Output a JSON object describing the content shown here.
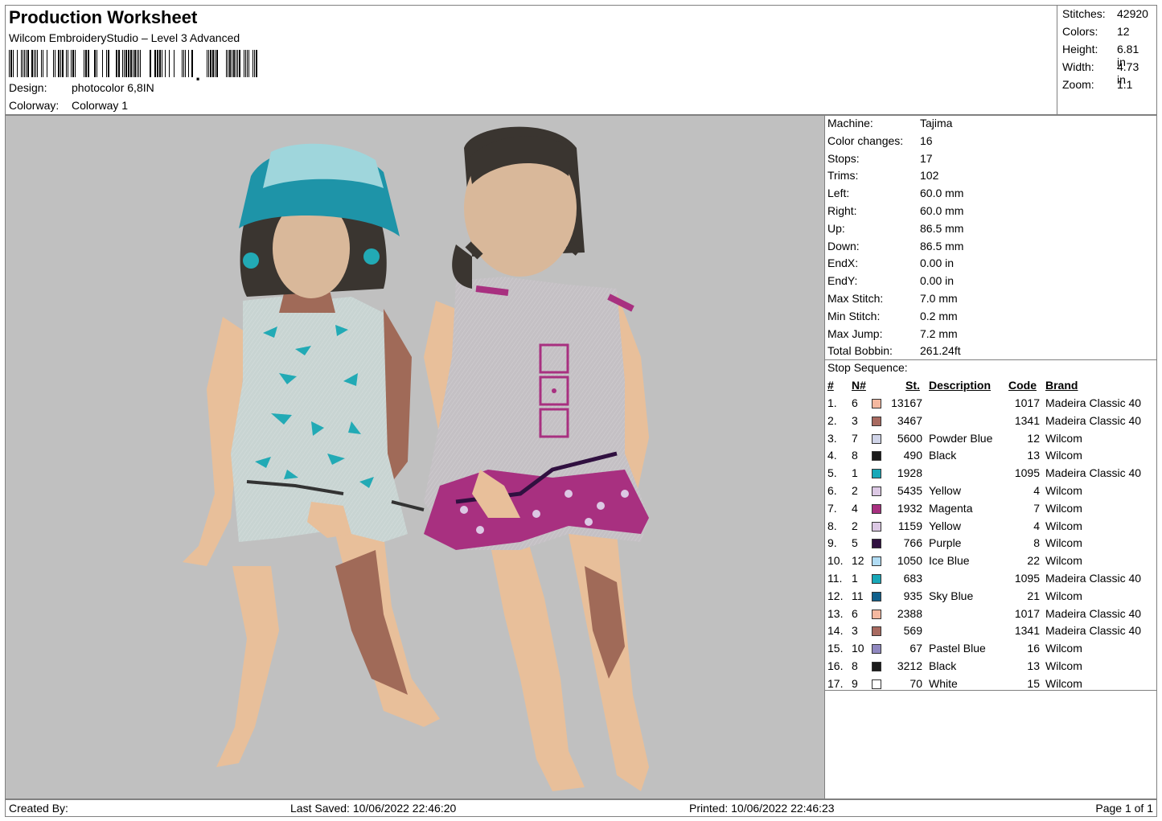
{
  "header": {
    "title": "Production Worksheet",
    "subtitle": "Wilcom EmbroideryStudio – Level 3 Advanced",
    "design_label": "Design:",
    "design_value": "photocolor 6,8IN",
    "colorway_label": "Colorway:",
    "colorway_value": "Colorway 1"
  },
  "stats": [
    {
      "label": "Stitches:",
      "value": "42920"
    },
    {
      "label": "Colors:",
      "value": "12"
    },
    {
      "label": "Height:",
      "value": "6.81 in"
    },
    {
      "label": "Width:",
      "value": "4.73 in"
    },
    {
      "label": "Zoom:",
      "value": "1:1"
    }
  ],
  "machine_info": [
    {
      "label": "Machine:",
      "value": "Tajima"
    },
    {
      "label": "Color changes:",
      "value": "16"
    },
    {
      "label": "Stops:",
      "value": "17"
    },
    {
      "label": "Trims:",
      "value": "102"
    },
    {
      "label": "Left:",
      "value": "60.0 mm"
    },
    {
      "label": "Right:",
      "value": "60.0 mm"
    },
    {
      "label": "Up:",
      "value": "86.5 mm"
    },
    {
      "label": "Down:",
      "value": "86.5 mm"
    },
    {
      "label": "EndX:",
      "value": "0.00 in"
    },
    {
      "label": "EndY:",
      "value": "0.00 in"
    },
    {
      "label": "Max Stitch:",
      "value": "7.0 mm"
    },
    {
      "label": "Min Stitch:",
      "value": "0.2 mm"
    },
    {
      "label": "Max Jump:",
      "value": "7.2 mm"
    },
    {
      "label": "Total Bobbin:",
      "value": "261.24ft"
    }
  ],
  "stop_sequence": {
    "title": "Stop Sequence:",
    "headers": {
      "num": "#",
      "n": "N#",
      "st": "St.",
      "desc": "Description",
      "code": "Code",
      "brand": "Brand"
    },
    "rows": [
      {
        "num": "1.",
        "n": "6",
        "color": "#f4b8a0",
        "st": "13167",
        "desc": "",
        "code": "1017",
        "brand": "Madeira Classic 40"
      },
      {
        "num": "2.",
        "n": "3",
        "color": "#a86a60",
        "st": "3467",
        "desc": "",
        "code": "1341",
        "brand": "Madeira Classic 40"
      },
      {
        "num": "3.",
        "n": "7",
        "color": "#d0d4e8",
        "st": "5600",
        "desc": "Powder Blue",
        "code": "12",
        "brand": "Wilcom"
      },
      {
        "num": "4.",
        "n": "8",
        "color": "#1a1a1a",
        "st": "490",
        "desc": "Black",
        "code": "13",
        "brand": "Wilcom"
      },
      {
        "num": "5.",
        "n": "1",
        "color": "#18a8b8",
        "st": "1928",
        "desc": "",
        "code": "1095",
        "brand": "Madeira Classic 40"
      },
      {
        "num": "6.",
        "n": "2",
        "color": "#dcc8e4",
        "st": "5435",
        "desc": "Yellow",
        "code": "4",
        "brand": "Wilcom"
      },
      {
        "num": "7.",
        "n": "4",
        "color": "#a83080",
        "st": "1932",
        "desc": "Magenta",
        "code": "7",
        "brand": "Wilcom"
      },
      {
        "num": "8.",
        "n": "2",
        "color": "#dcc8e4",
        "st": "1159",
        "desc": "Yellow",
        "code": "4",
        "brand": "Wilcom"
      },
      {
        "num": "9.",
        "n": "5",
        "color": "#301040",
        "st": "766",
        "desc": "Purple",
        "code": "8",
        "brand": "Wilcom"
      },
      {
        "num": "10.",
        "n": "12",
        "color": "#b0dcf4",
        "st": "1050",
        "desc": "Ice Blue",
        "code": "22",
        "brand": "Wilcom"
      },
      {
        "num": "11.",
        "n": "1",
        "color": "#18a8b8",
        "st": "683",
        "desc": "",
        "code": "1095",
        "brand": "Madeira Classic 40"
      },
      {
        "num": "12.",
        "n": "11",
        "color": "#10608c",
        "st": "935",
        "desc": "Sky Blue",
        "code": "21",
        "brand": "Wilcom"
      },
      {
        "num": "13.",
        "n": "6",
        "color": "#f4b8a0",
        "st": "2388",
        "desc": "",
        "code": "1017",
        "brand": "Madeira Classic 40"
      },
      {
        "num": "14.",
        "n": "3",
        "color": "#a86a60",
        "st": "569",
        "desc": "",
        "code": "1341",
        "brand": "Madeira Classic 40"
      },
      {
        "num": "15.",
        "n": "10",
        "color": "#9088c0",
        "st": "67",
        "desc": "Pastel Blue",
        "code": "16",
        "brand": "Wilcom"
      },
      {
        "num": "16.",
        "n": "8",
        "color": "#1a1a1a",
        "st": "3212",
        "desc": "Black",
        "code": "13",
        "brand": "Wilcom"
      },
      {
        "num": "17.",
        "n": "9",
        "color": "#ffffff",
        "st": "70",
        "desc": "White",
        "code": "15",
        "brand": "Wilcom"
      }
    ]
  },
  "footer": {
    "created_by": "Created By:",
    "last_saved": "Last Saved: 10/06/2022 22:46:20",
    "printed": "Printed: 10/06/2022 22:46:23",
    "page": "Page 1 of 1"
  },
  "barcode_trailer": ","
}
